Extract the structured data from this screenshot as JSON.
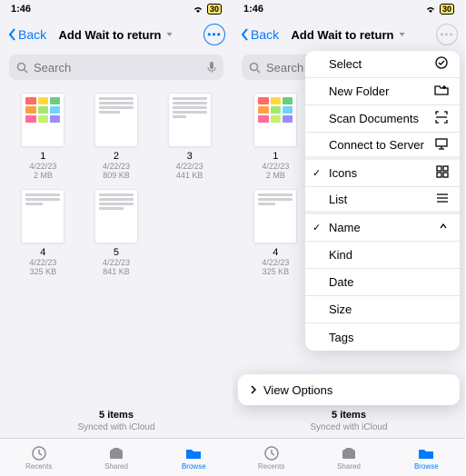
{
  "statusbar": {
    "time": "1:46",
    "battery": "30"
  },
  "nav": {
    "back": "Back",
    "title": "Add Wait to return"
  },
  "search": {
    "placeholder": "Search"
  },
  "files": [
    {
      "name": "1",
      "date": "4/22/23",
      "size": "2 MB",
      "kind": "color"
    },
    {
      "name": "2",
      "date": "4/22/23",
      "size": "809 KB",
      "kind": "text"
    },
    {
      "name": "3",
      "date": "4/22/23",
      "size": "441 KB",
      "kind": "text"
    },
    {
      "name": "4",
      "date": "4/22/23",
      "size": "325 KB",
      "kind": "text"
    },
    {
      "name": "5",
      "date": "4/22/23",
      "size": "841 KB",
      "kind": "text"
    }
  ],
  "footer": {
    "count": "5 items",
    "sync": "Synced with iCloud"
  },
  "tabs": {
    "recents": "Recents",
    "shared": "Shared",
    "browse": "Browse"
  },
  "menu": {
    "select": "Select",
    "newfolder": "New Folder",
    "scan": "Scan Documents",
    "connect": "Connect to Server",
    "icons": "Icons",
    "list": "List",
    "name": "Name",
    "kind": "Kind",
    "date": "Date",
    "size": "Size",
    "tags": "Tags",
    "viewoptions": "View Options"
  }
}
